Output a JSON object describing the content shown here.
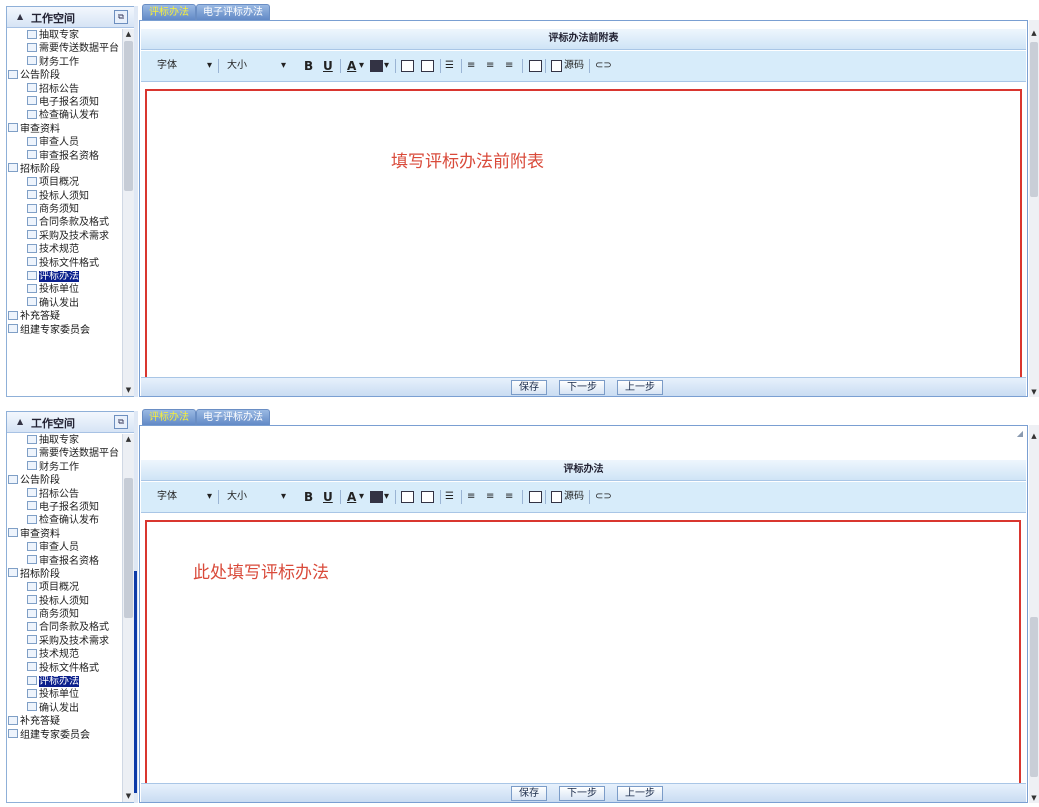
{
  "panels": [
    {
      "workspace_title": "工作空间",
      "tree_items": [
        {
          "label": "抽取专家",
          "level": 1
        },
        {
          "label": "需要传送数据平台",
          "level": 1
        },
        {
          "label": "财务工作",
          "level": 1
        },
        {
          "label": "公告阶段",
          "level": 0
        },
        {
          "label": "招标公告",
          "level": 1
        },
        {
          "label": "电子报名须知",
          "level": 1
        },
        {
          "label": "检查确认发布",
          "level": 1
        },
        {
          "label": "审查资料",
          "level": 0
        },
        {
          "label": "审查人员",
          "level": 1
        },
        {
          "label": "审查报名资格",
          "level": 1
        },
        {
          "label": "招标阶段",
          "level": 0
        },
        {
          "label": "项目概况",
          "level": 1
        },
        {
          "label": "投标人须知",
          "level": 1
        },
        {
          "label": "商务须知",
          "level": 1
        },
        {
          "label": "合同条款及格式",
          "level": 1
        },
        {
          "label": "采购及技术需求",
          "level": 1
        },
        {
          "label": "技术规范",
          "level": 1
        },
        {
          "label": "投标文件格式",
          "level": 1
        },
        {
          "label": "评标办法",
          "level": 1,
          "selected": true
        },
        {
          "label": "投标单位",
          "level": 1
        },
        {
          "label": "确认发出",
          "level": 1
        },
        {
          "label": "补充答疑",
          "level": 0
        },
        {
          "label": "组建专家委员会",
          "level": 0
        }
      ],
      "tabs": [
        "评标办法",
        "电子评标办法"
      ],
      "form_title": "评标办法前附表",
      "toolbar": {
        "font": "字体",
        "size": "大小",
        "bold": "B",
        "underline": "U",
        "font_color": "A",
        "source": "源码"
      },
      "editor_text": "填写评标办法前附表",
      "buttons": {
        "save": "保存",
        "next": "下一步",
        "prev": "上一步"
      }
    },
    {
      "workspace_title": "工作空间",
      "tree_items": [
        {
          "label": "抽取专家",
          "level": 1
        },
        {
          "label": "需要传送数据平台",
          "level": 1
        },
        {
          "label": "财务工作",
          "level": 1
        },
        {
          "label": "公告阶段",
          "level": 0
        },
        {
          "label": "招标公告",
          "level": 1
        },
        {
          "label": "电子报名须知",
          "level": 1
        },
        {
          "label": "检查确认发布",
          "level": 1
        },
        {
          "label": "审查资料",
          "level": 0
        },
        {
          "label": "审查人员",
          "level": 1
        },
        {
          "label": "审查报名资格",
          "level": 1
        },
        {
          "label": "招标阶段",
          "level": 0
        },
        {
          "label": "项目概况",
          "level": 1
        },
        {
          "label": "投标人须知",
          "level": 1
        },
        {
          "label": "商务须知",
          "level": 1
        },
        {
          "label": "合同条款及格式",
          "level": 1
        },
        {
          "label": "采购及技术需求",
          "level": 1
        },
        {
          "label": "技术规范",
          "level": 1
        },
        {
          "label": "投标文件格式",
          "level": 1
        },
        {
          "label": "评标办法",
          "level": 1,
          "selected": true
        },
        {
          "label": "投标单位",
          "level": 1
        },
        {
          "label": "确认发出",
          "level": 1
        },
        {
          "label": "补充答疑",
          "level": 0
        },
        {
          "label": "组建专家委员会",
          "level": 0
        }
      ],
      "tabs": [
        "评标办法",
        "电子评标办法"
      ],
      "form_title": "评标办法",
      "toolbar": {
        "font": "字体",
        "size": "大小",
        "bold": "B",
        "underline": "U",
        "font_color": "A",
        "source": "源码"
      },
      "editor_text": "此处填写评标办法",
      "buttons": {
        "save": "保存",
        "next": "下一步",
        "prev": "上一步"
      }
    }
  ],
  "colors": {
    "selected_bg": "#0a1f8c",
    "editor_border": "#d9362f",
    "editor_text": "#d94a3a",
    "active_tab_text": "#f6ef3a"
  }
}
